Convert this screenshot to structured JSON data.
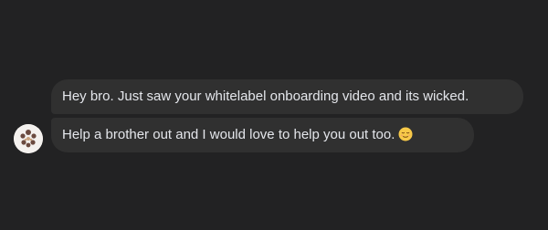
{
  "conversation": {
    "sender_avatar_icon": "avatar-icon",
    "messages": [
      {
        "text": "Hey bro. Just saw your whitelabel onboarding video and its wicked."
      },
      {
        "text": "Help a brother out and I would love to help you out too.",
        "emoji": "relieved-face-emoji"
      }
    ]
  },
  "colors": {
    "background": "#222223",
    "bubble": "#303030",
    "text": "#e4e6eb"
  }
}
